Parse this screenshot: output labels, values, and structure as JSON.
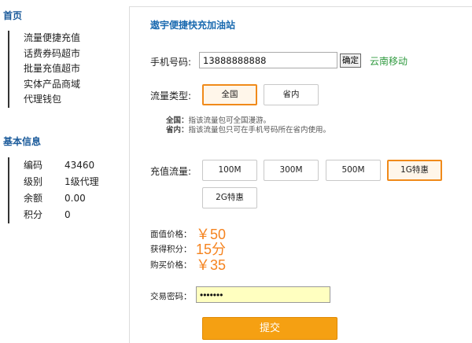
{
  "sidebar": {
    "home_title": "首页",
    "nav_items": [
      {
        "label": "流量便捷充值"
      },
      {
        "label": "话费券码超市"
      },
      {
        "label": "批量充值超市"
      },
      {
        "label": "实体产品商域"
      },
      {
        "label": "代理钱包"
      }
    ],
    "info_title": "基本信息",
    "info": [
      {
        "key": "编码",
        "value": "43460"
      },
      {
        "key": "级别",
        "value": "1级代理"
      },
      {
        "key": "余额",
        "value": "0.00"
      },
      {
        "key": "积分",
        "value": "0"
      }
    ]
  },
  "main": {
    "title": "遨宇便捷快充加油站",
    "phone_label": "手机号码:",
    "phone_value": "13888888888",
    "confirm_label": "确定",
    "carrier": "云南移动",
    "type_label": "流量类型:",
    "types": [
      {
        "label": "全国",
        "selected": true
      },
      {
        "label": "省内",
        "selected": false
      }
    ],
    "note_national_key": "全国：",
    "note_national_text": "指该流量包可全国漫游。",
    "note_province_key": "省内：",
    "note_province_text": "指该流量包只可在手机号码所在省内使用。",
    "amount_label": "充值流量:",
    "amounts": [
      {
        "label": "100M",
        "selected": false
      },
      {
        "label": "300M",
        "selected": false
      },
      {
        "label": "500M",
        "selected": false
      },
      {
        "label": "1G特惠",
        "selected": true
      },
      {
        "label": "2G特惠",
        "selected": false
      }
    ],
    "face_price_label": "面值价格：",
    "face_price_value": "￥50",
    "points_label": "获得积分：",
    "points_value": "15分",
    "buy_price_label": "购买价格：",
    "buy_price_value": "￥35",
    "password_label": "交易密码：",
    "password_value": "•••••••",
    "submit_label": "提交"
  },
  "colors": {
    "accent": "#f08a1a",
    "submit_bg": "#f5a012",
    "title_blue": "#1a6ab0",
    "sidebar_blue": "#1a5a9a",
    "carrier_green": "#2f9a3f",
    "password_bg": "#ffffc0"
  }
}
